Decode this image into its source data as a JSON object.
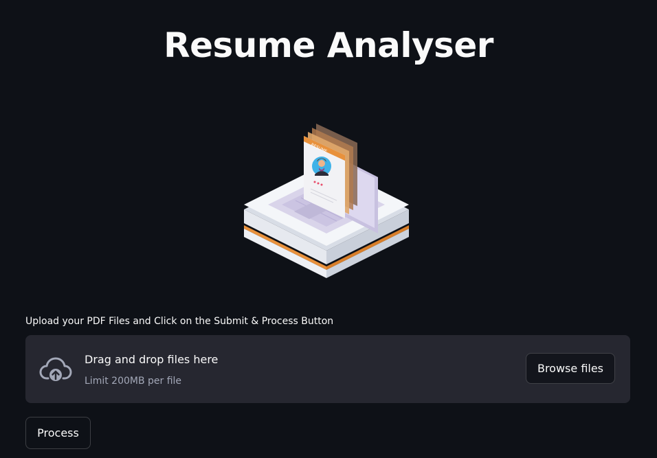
{
  "header": {
    "title": "Resume Analyser"
  },
  "hero": {
    "image_label": "RESUME",
    "icon": "resume-laptop-illustration"
  },
  "uploader": {
    "label": "Upload your PDF Files and Click on the Submit & Process Button",
    "dropzone_title": "Drag and drop files here",
    "dropzone_subtitle": "Limit 200MB per file",
    "browse_label": "Browse files",
    "icon": "cloud-upload-icon"
  },
  "actions": {
    "process_label": "Process"
  },
  "colors": {
    "background": "#0e1117",
    "dropzone": "#262730",
    "text": "#fafafa",
    "muted_text": "#a3a8b8",
    "accent_orange": "#e8913c"
  }
}
